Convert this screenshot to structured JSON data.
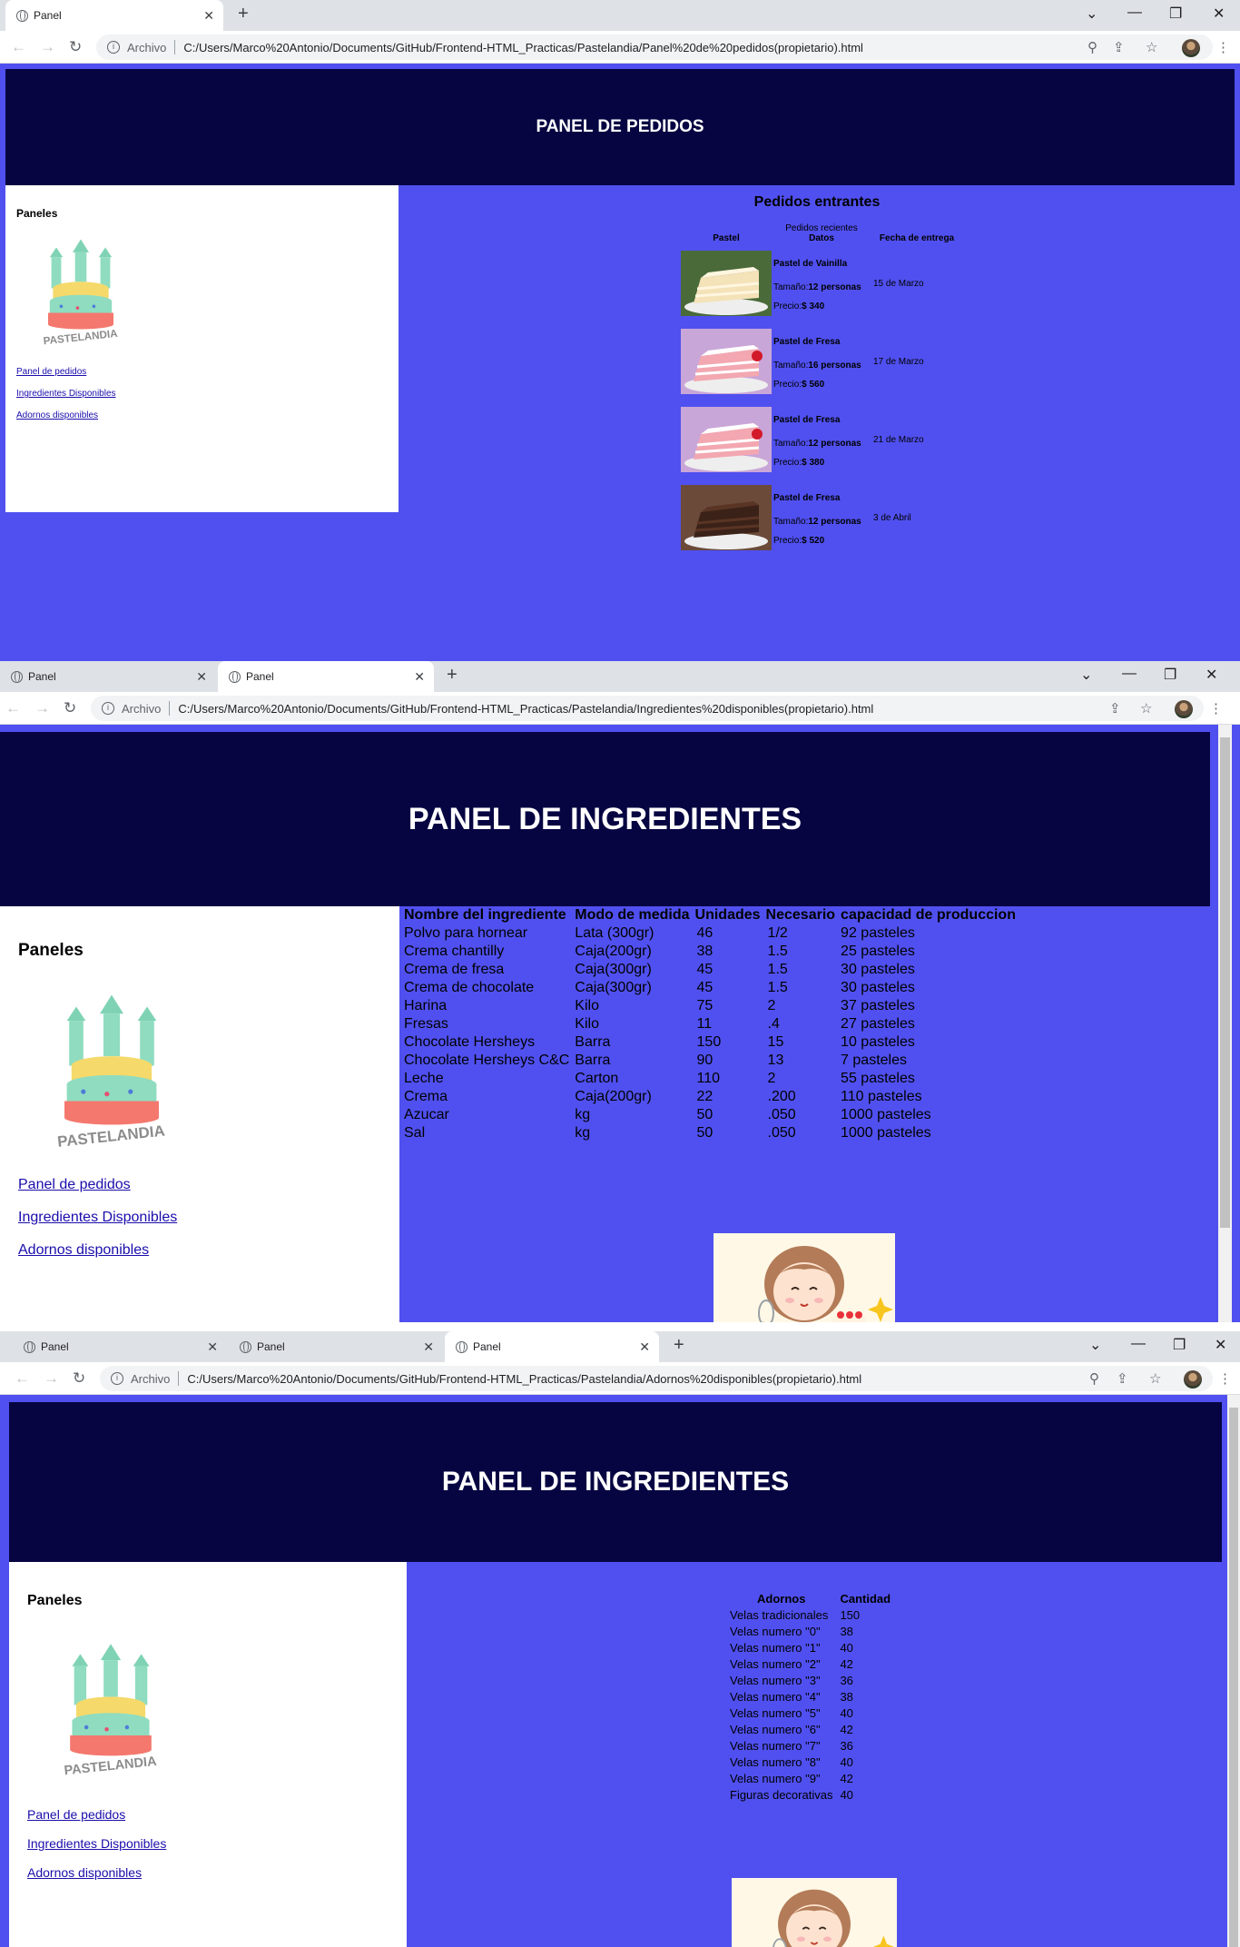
{
  "browser": {
    "tab_title": "Panel",
    "archivo_label": "Archivo",
    "url_pedidos": "C:/Users/Marco%20Antonio/Documents/GitHub/Frontend-HTML_Practicas/Pastelandia/Panel%20de%20pedidos(propietario).html",
    "url_ingredientes": "C:/Users/Marco%20Antonio/Documents/GitHub/Frontend-HTML_Practicas/Pastelandia/Ingredientes%20disponibles(propietario).html",
    "url_adornos": "C:/Users/Marco%20Antonio/Documents/GitHub/Frontend-HTML_Practicas/Pastelandia/Adornos%20disponibles(propietario).html"
  },
  "sidebar": {
    "title": "Paneles",
    "logo_text": "PASTELANDIA",
    "links": [
      "Panel de pedidos",
      "Ingredientes Disponibles",
      "Adornos disponibles"
    ]
  },
  "pedidos": {
    "header": "PANEL DE PEDIDOS",
    "section_title": "Pedidos entrantes",
    "caption": "Pedidos recientes",
    "columns": [
      "Pastel",
      "Datos",
      "Fecha de entrega"
    ],
    "size_label": "Tamaño:",
    "price_label": "Precio:",
    "orders": [
      {
        "name": "Pastel de Vainilla",
        "size": "12 personas",
        "price": "$ 340",
        "date": "15 de Marzo",
        "cake": "vanilla"
      },
      {
        "name": "Pastel de Fresa",
        "size": "16 personas",
        "price": "$ 560",
        "date": "17 de Marzo",
        "cake": "strawberry"
      },
      {
        "name": "Pastel de Fresa",
        "size": "12 personas",
        "price": "$ 380",
        "date": "21 de Marzo",
        "cake": "strawberry"
      },
      {
        "name": "Pastel de Fresa",
        "size": "12 personas",
        "price": "$ 520",
        "date": "3 de Abril",
        "cake": "chocolate"
      }
    ]
  },
  "ingredientes": {
    "header": "PANEL DE INGREDIENTES",
    "columns": [
      "Nombre del ingrediente",
      "Modo de medida",
      "Unidades",
      "Necesario",
      "capacidad de produccion"
    ],
    "rows": [
      [
        "Polvo para hornear",
        "Lata (300gr)",
        "46",
        "1/2",
        "92 pasteles"
      ],
      [
        "Crema chantilly",
        "Caja(200gr)",
        "38",
        "1.5",
        "25 pasteles"
      ],
      [
        "Crema de fresa",
        "Caja(300gr)",
        "45",
        "1.5",
        "30 pasteles"
      ],
      [
        "Crema de chocolate",
        "Caja(300gr)",
        "45",
        "1.5",
        "30 pasteles"
      ],
      [
        "Harina",
        "Kilo",
        "75",
        "2",
        "37 pasteles"
      ],
      [
        "Fresas",
        "Kilo",
        "11",
        ".4",
        "27 pasteles"
      ],
      [
        "Chocolate Hersheys",
        "Barra",
        "150",
        "15",
        "10 pasteles"
      ],
      [
        "Chocolate Hersheys C&C",
        "Barra",
        "90",
        "13",
        "7 pasteles"
      ],
      [
        "Leche",
        "Carton",
        "110",
        "2",
        "55 pasteles"
      ],
      [
        "Crema",
        "Caja(200gr)",
        "22",
        ".200",
        "110 pasteles"
      ],
      [
        "Azucar",
        "kg",
        "50",
        ".050",
        "1000 pasteles"
      ],
      [
        "Sal",
        "kg",
        "50",
        ".050",
        "1000 pasteles"
      ]
    ]
  },
  "adornos": {
    "header": "PANEL DE INGREDIENTES",
    "columns": [
      "Adornos",
      "Cantidad"
    ],
    "rows": [
      [
        "Velas tradicionales",
        "150"
      ],
      [
        "Velas numero \"0\"",
        "38"
      ],
      [
        "Velas numero \"1\"",
        "40"
      ],
      [
        "Velas numero \"2\"",
        "42"
      ],
      [
        "Velas numero \"3\"",
        "36"
      ],
      [
        "Velas numero \"4\"",
        "38"
      ],
      [
        "Velas numero \"5\"",
        "40"
      ],
      [
        "Velas numero \"6\"",
        "42"
      ],
      [
        "Velas numero \"7\"",
        "36"
      ],
      [
        "Velas numero \"8\"",
        "40"
      ],
      [
        "Velas numero \"9\"",
        "42"
      ],
      [
        "Figuras decorativas",
        "40"
      ]
    ]
  },
  "colors": {
    "page_background": "#5050f0",
    "header_background": "#060542",
    "sidebar_background": "#ffffff"
  }
}
